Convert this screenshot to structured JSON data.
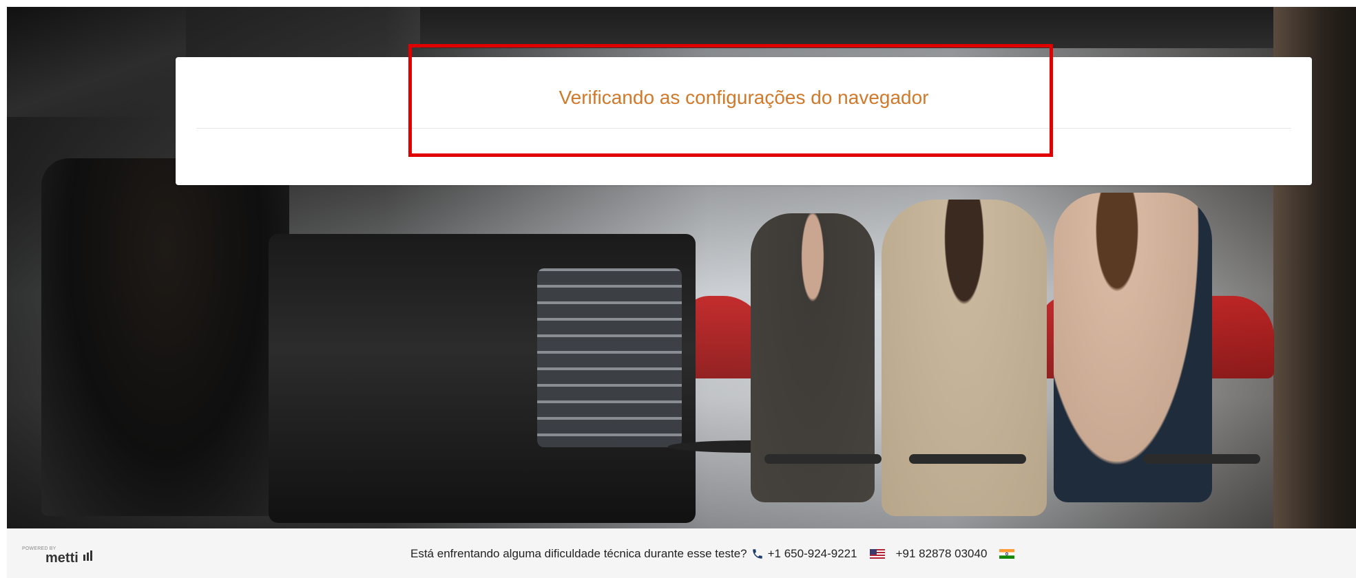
{
  "card": {
    "title": "Verificando as configurações do navegador"
  },
  "footer": {
    "powered_small": "POWERED BY",
    "brand": "metti",
    "support_text": "Está enfrentando alguma dificuldade técnica durante esse teste?",
    "phone_us": "+1 650-924-9221",
    "phone_in": "+91 82878 03040",
    "icons": [
      "phone-icon",
      "us-flag-icon",
      "india-flag-icon"
    ]
  },
  "colors": {
    "title": "#d1792b",
    "highlight": "#e00000",
    "footer_bg": "#f5f5f5"
  }
}
